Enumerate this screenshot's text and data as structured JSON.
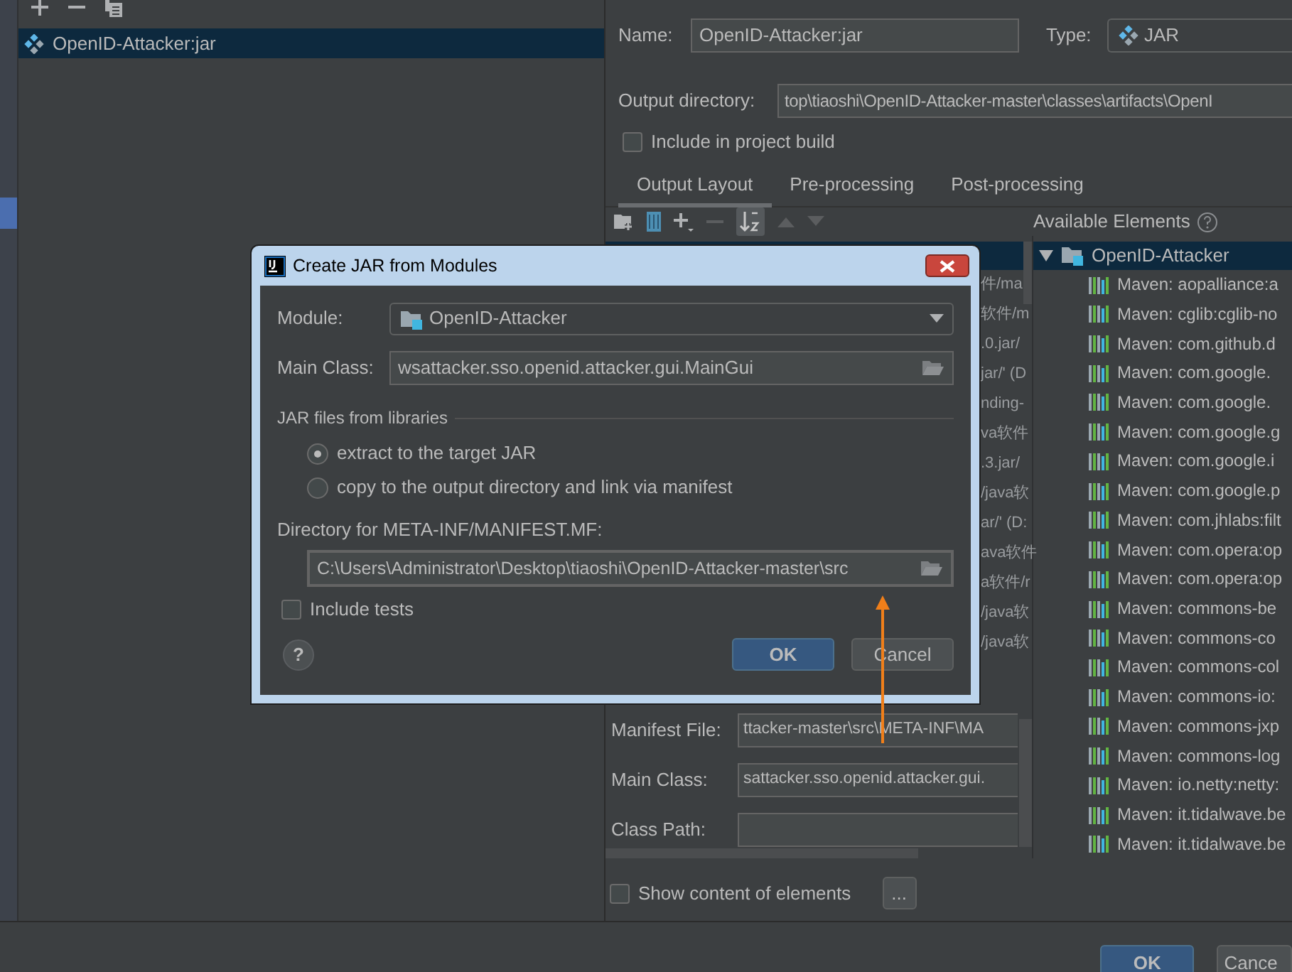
{
  "artifacts": [
    {
      "label": "OpenID-Attacker:jar",
      "selected": true
    }
  ],
  "artifact_form": {
    "name_label": "Name:",
    "name_value": "OpenID-Attacker:jar",
    "type_label": "Type:",
    "type_value": "JAR",
    "output_directory_label": "Output directory:",
    "output_directory_value": "top\\tiaoshi\\OpenID-Attacker-master\\classes\\artifacts\\OpenI",
    "include_in_build": {
      "label": "Include in project build",
      "checked": false
    }
  },
  "tabs": [
    {
      "label": "Output Layout",
      "selected": true
    },
    {
      "label": "Pre-processing",
      "selected": false
    },
    {
      "label": "Post-processing",
      "selected": false
    }
  ],
  "available_label": "Available Elements",
  "output_tree_fragments": [
    "件/ma",
    "软件/m",
    ".0.jar/",
    "jar/' (D",
    "nding-",
    "va软件",
    ".3.jar/",
    "/java软",
    "ar/' (D:",
    "ava软件",
    "a软件/r",
    "/java软",
    "/java软"
  ],
  "available_elements": {
    "label": "OpenID-Attacker",
    "expanded": true,
    "children": [
      {
        "label": "Maven: aopalliance:a"
      },
      {
        "label": "Maven: cglib:cglib-no"
      },
      {
        "label": "Maven: com.github.d"
      },
      {
        "label": "Maven: com.google."
      },
      {
        "label": "Maven: com.google."
      },
      {
        "label": "Maven: com.google.g"
      },
      {
        "label": "Maven: com.google.i"
      },
      {
        "label": "Maven: com.google.p"
      },
      {
        "label": "Maven: com.jhlabs:filt"
      },
      {
        "label": "Maven: com.opera:op"
      },
      {
        "label": "Maven: com.opera:op"
      },
      {
        "label": "Maven: commons-be"
      },
      {
        "label": "Maven: commons-co"
      },
      {
        "label": "Maven: commons-col"
      },
      {
        "label": "Maven: commons-io:"
      },
      {
        "label": "Maven: commons-jxp"
      },
      {
        "label": "Maven: commons-log"
      },
      {
        "label": "Maven: io.netty:netty:"
      },
      {
        "label": "Maven: it.tidalwave.be"
      },
      {
        "label": "Maven: it.tidalwave.be"
      }
    ]
  },
  "manifest_fields": [
    {
      "label": "Manifest File:",
      "value": "ttacker-master\\src\\META-INF\\MA"
    },
    {
      "label": "Main Class:",
      "value": "sattacker.sso.openid.attacker.gui."
    },
    {
      "label": "Class Path:"
    }
  ],
  "show_content": {
    "label": "Show content of elements",
    "checked": false
  },
  "ellipsis_button": "...",
  "footer_buttons": [
    "OK",
    "Cance"
  ],
  "dialog": {
    "title": "Create JAR from Modules",
    "module_label": "Module:",
    "module_value": "OpenID-Attacker",
    "main_class_label": "Main Class:",
    "main_class_value": "wsattacker.sso.openid.attacker.gui.MainGui",
    "section": "JAR files from libraries",
    "options": [
      {
        "label": "extract to the target JAR",
        "selected": true
      },
      {
        "label": "copy to the output directory and link via manifest",
        "selected": false
      }
    ],
    "manifest_dir_label": "Directory for META-INF/MANIFEST.MF:",
    "manifest_dir_value": "C:\\Users\\Administrator\\Desktop\\tiaoshi\\OpenID-Attacker-master\\src",
    "include_tests": {
      "label": "Include tests",
      "checked": false
    },
    "help": "?",
    "buttons": [
      "OK",
      "Cancel"
    ]
  }
}
